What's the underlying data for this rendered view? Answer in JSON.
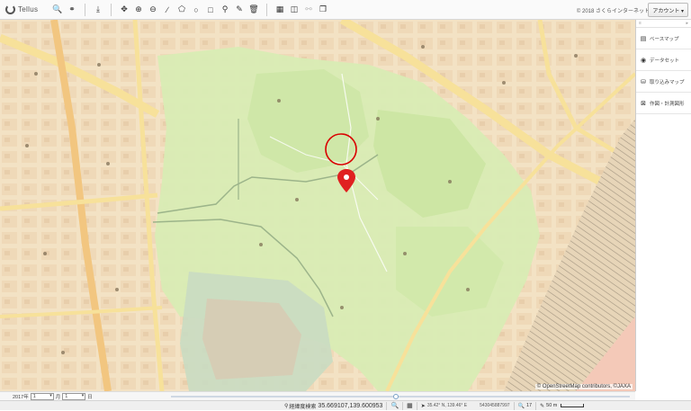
{
  "app": {
    "name": "Tellus"
  },
  "toolbar": {
    "groups": [
      [
        {
          "name": "search-icon",
          "glyph": "🔍",
          "interactive": true
        },
        {
          "name": "binoculars-icon",
          "glyph": "⚭",
          "interactive": true
        }
      ],
      [
        {
          "name": "download-icon",
          "glyph": "⤓",
          "interactive": true
        }
      ],
      [
        {
          "name": "move-icon",
          "glyph": "✥",
          "interactive": true
        },
        {
          "name": "zoom-in-icon",
          "glyph": "⊕",
          "interactive": true
        },
        {
          "name": "zoom-out-icon",
          "glyph": "⊖",
          "interactive": true
        },
        {
          "name": "line-draw-icon",
          "glyph": "∕",
          "interactive": true
        },
        {
          "name": "polygon-draw-icon",
          "glyph": "⬠",
          "interactive": true
        },
        {
          "name": "circle-draw-icon",
          "glyph": "○",
          "interactive": true
        },
        {
          "name": "rectangle-draw-icon",
          "glyph": "□",
          "interactive": true
        },
        {
          "name": "marker-icon",
          "glyph": "⚲",
          "interactive": true
        },
        {
          "name": "edit-icon",
          "glyph": "✎",
          "interactive": true
        },
        {
          "name": "trash-icon",
          "glyph": "🗑",
          "interactive": true
        }
      ],
      [
        {
          "name": "calendar-icon",
          "glyph": "▦",
          "interactive": true
        },
        {
          "name": "split-view-icon",
          "glyph": "◫",
          "interactive": true
        },
        {
          "name": "link-icon",
          "glyph": "⚯",
          "interactive": false
        },
        {
          "name": "layers-copy-icon",
          "glyph": "❐",
          "interactive": true
        }
      ]
    ]
  },
  "header": {
    "copyright": "© 2018 さくらインターネット",
    "account_label": "アカウント ▾"
  },
  "panel": {
    "top_left": "≡",
    "top_right": "▸",
    "items": [
      {
        "icon": "base-map-icon",
        "glyph": "▤",
        "label": "ベースマップ"
      },
      {
        "icon": "dataset-icon",
        "glyph": "◉",
        "label": "データセット"
      },
      {
        "icon": "import-map-icon",
        "glyph": "⛁",
        "label": "取り込みマップ"
      },
      {
        "icon": "drawing-icon",
        "glyph": "⊠",
        "label": "作図・計測図形"
      }
    ]
  },
  "map": {
    "attribution": "© OpenStreetMap contributors, ©JAXA"
  },
  "timebar": {
    "year_label": "2017年",
    "month_value": "1",
    "month_unit": "月",
    "day_value": "1",
    "day_unit": "日",
    "slider_fraction": 0.49
  },
  "statusbar": {
    "coordinate_label": "経緯度検索",
    "coordinate_value": "35.669107,139.600953",
    "latlon_dms": "35.42° N, 139.46° E",
    "mesh_code": "543045887997",
    "zoom_level": "17",
    "scale_label": "50 m"
  },
  "colors": {
    "park_green": "#d8ecb4",
    "urban_beige": "#f3e2c4",
    "road_yellow": "#f7e19a",
    "road_orange": "#f2c680",
    "marker_red": "#e02020",
    "circle_red": "#d90000",
    "rail_gray": "#9a9080"
  }
}
